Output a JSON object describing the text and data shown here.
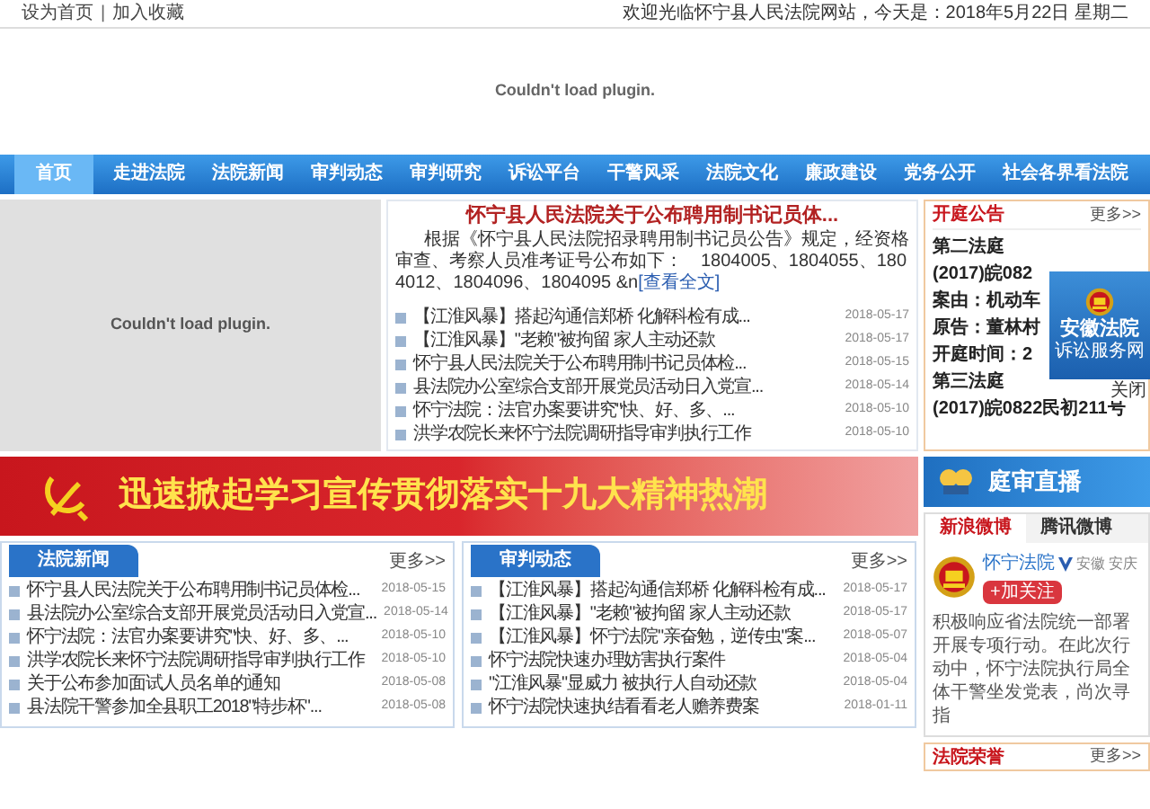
{
  "top_bar": {
    "links": [
      {
        "label": "设为首页"
      },
      {
        "label": "加入收藏"
      }
    ],
    "separator": "|",
    "welcome": "欢迎光临怀宁县人民法院网站，今天是：2018年5月22日 星期二"
  },
  "header_plugin": {
    "message": "Couldn't load plugin."
  },
  "nav": [
    {
      "label": "首页",
      "selected": true
    },
    {
      "label": "走进法院",
      "selected": false
    },
    {
      "label": "法院新闻",
      "selected": false
    },
    {
      "label": "审判动态",
      "selected": false
    },
    {
      "label": "审判研究",
      "selected": false
    },
    {
      "label": "诉讼平台",
      "selected": false
    },
    {
      "label": "干警风采",
      "selected": false
    },
    {
      "label": "法院文化",
      "selected": false
    },
    {
      "label": "廉政建设",
      "selected": false
    },
    {
      "label": "党务公开",
      "selected": false
    },
    {
      "label": "社会各界看法院",
      "selected": false
    }
  ],
  "slideshow": {
    "message": "Couldn't load plugin."
  },
  "headline": {
    "title": "怀宁县人民法院关于公布聘用制书记员体...",
    "summary": "根据《怀宁县人民法院招录聘用制书记员公告》规定，经资格审查、考察人员准考证号公布如下：　1804005、1804055、1804012、1804096、1804095 &n",
    "link": "[查看全文]"
  },
  "headline_list": [
    {
      "title": "【江淮风暴】搭起沟通信郑桥 化解科检有成...",
      "date": "2018-05-17"
    },
    {
      "title": "【江淮风暴】\"老赖\"被拘留 家人主动还款",
      "date": "2018-05-17"
    },
    {
      "title": "怀宁县人民法院关于公布聘用制书记员体检...",
      "date": "2018-05-15"
    },
    {
      "title": "县法院办公室综合支部开展党员活动日入党宣...",
      "date": "2018-05-14"
    },
    {
      "title": "怀宁法院：法官办案要讲究\"快、好、多、...",
      "date": "2018-05-10"
    },
    {
      "title": "洪学农院长来怀宁法院调研指导审判执行工作",
      "date": "2018-05-10"
    }
  ],
  "notices": {
    "title": "开庭公告",
    "more": "更多>>",
    "lines": [
      {
        "text": "第二法庭"
      },
      {
        "text": "(2017)皖082"
      },
      {
        "text": "案由：机动车"
      },
      {
        "text": "原告：董林村"
      },
      {
        "text": "开庭时间：2"
      },
      {
        "text": "第三法庭"
      },
      {
        "text": "(2017)皖0822民初211号"
      }
    ]
  },
  "popup": {
    "title": "安徽法院",
    "subtitle": "诉讼服务网",
    "close": "关闭"
  },
  "banner": {
    "text": "迅速掀起学习宣传贯彻落实十九大精神热潮"
  },
  "live_banner": {
    "text": "庭审直播"
  },
  "weibo": {
    "tabs": [
      {
        "label": "新浪微博",
        "selected": true
      },
      {
        "label": "腾讯微博",
        "selected": false
      }
    ],
    "name": "怀宁法院",
    "location": "安徽 安庆",
    "follow": "+加关注",
    "text": "积极响应省法院统一部署开展专项行动。在此次行动中，怀宁法院执行局全体干警坐发党表，尚次寻指"
  },
  "honors": {
    "title": "法院荣誉",
    "more": "更多>>"
  },
  "news": {
    "title": "法院新闻",
    "more": "更多>>",
    "items": [
      {
        "title": "怀宁县人民法院关于公布聘用制书记员体检...",
        "date": "2018-05-15"
      },
      {
        "title": "县法院办公室综合支部开展党员活动日入党宣...",
        "date": "2018-05-14"
      },
      {
        "title": "怀宁法院：法官办案要讲究\"快、好、多、...",
        "date": "2018-05-10"
      },
      {
        "title": "洪学农院长来怀宁法院调研指导审判执行工作",
        "date": "2018-05-10"
      },
      {
        "title": "关于公布参加面试人员名单的通知",
        "date": "2018-05-08"
      },
      {
        "title": "县法院干警参加全县职工2018\"特步杯\"...",
        "date": "2018-05-08"
      }
    ]
  },
  "trials": {
    "title": "审判动态",
    "more": "更多>>",
    "items": [
      {
        "title": "【江淮风暴】搭起沟通信郑桥 化解科检有成...",
        "date": "2018-05-17"
      },
      {
        "title": "【江淮风暴】\"老赖\"被拘留 家人主动还款",
        "date": "2018-05-17"
      },
      {
        "title": "【江淮风暴】怀宁法院\"亲奋勉，逆传虫\"案...",
        "date": "2018-05-07"
      },
      {
        "title": "怀宁法院快速办理妨害执行案件",
        "date": "2018-05-04"
      },
      {
        "title": "\"江淮风暴\"显威力 被执行人自动还款",
        "date": "2018-05-04"
      },
      {
        "title": "怀宁法院快速执结看看老人赡养费案",
        "date": "2018-01-11"
      }
    ]
  }
}
